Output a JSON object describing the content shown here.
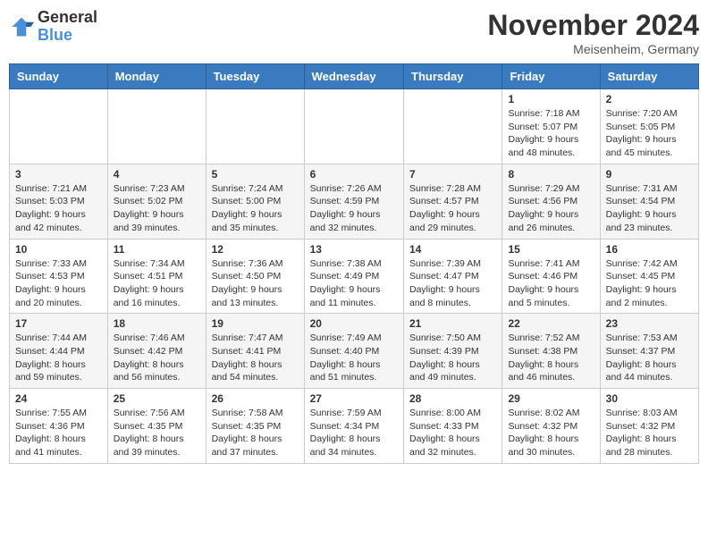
{
  "logo": {
    "general": "General",
    "blue": "Blue"
  },
  "title": "November 2024",
  "location": "Meisenheim, Germany",
  "days_of_week": [
    "Sunday",
    "Monday",
    "Tuesday",
    "Wednesday",
    "Thursday",
    "Friday",
    "Saturday"
  ],
  "weeks": [
    [
      {
        "day": "",
        "info": ""
      },
      {
        "day": "",
        "info": ""
      },
      {
        "day": "",
        "info": ""
      },
      {
        "day": "",
        "info": ""
      },
      {
        "day": "",
        "info": ""
      },
      {
        "day": "1",
        "info": "Sunrise: 7:18 AM\nSunset: 5:07 PM\nDaylight: 9 hours and 48 minutes."
      },
      {
        "day": "2",
        "info": "Sunrise: 7:20 AM\nSunset: 5:05 PM\nDaylight: 9 hours and 45 minutes."
      }
    ],
    [
      {
        "day": "3",
        "info": "Sunrise: 7:21 AM\nSunset: 5:03 PM\nDaylight: 9 hours and 42 minutes."
      },
      {
        "day": "4",
        "info": "Sunrise: 7:23 AM\nSunset: 5:02 PM\nDaylight: 9 hours and 39 minutes."
      },
      {
        "day": "5",
        "info": "Sunrise: 7:24 AM\nSunset: 5:00 PM\nDaylight: 9 hours and 35 minutes."
      },
      {
        "day": "6",
        "info": "Sunrise: 7:26 AM\nSunset: 4:59 PM\nDaylight: 9 hours and 32 minutes."
      },
      {
        "day": "7",
        "info": "Sunrise: 7:28 AM\nSunset: 4:57 PM\nDaylight: 9 hours and 29 minutes."
      },
      {
        "day": "8",
        "info": "Sunrise: 7:29 AM\nSunset: 4:56 PM\nDaylight: 9 hours and 26 minutes."
      },
      {
        "day": "9",
        "info": "Sunrise: 7:31 AM\nSunset: 4:54 PM\nDaylight: 9 hours and 23 minutes."
      }
    ],
    [
      {
        "day": "10",
        "info": "Sunrise: 7:33 AM\nSunset: 4:53 PM\nDaylight: 9 hours and 20 minutes."
      },
      {
        "day": "11",
        "info": "Sunrise: 7:34 AM\nSunset: 4:51 PM\nDaylight: 9 hours and 16 minutes."
      },
      {
        "day": "12",
        "info": "Sunrise: 7:36 AM\nSunset: 4:50 PM\nDaylight: 9 hours and 13 minutes."
      },
      {
        "day": "13",
        "info": "Sunrise: 7:38 AM\nSunset: 4:49 PM\nDaylight: 9 hours and 11 minutes."
      },
      {
        "day": "14",
        "info": "Sunrise: 7:39 AM\nSunset: 4:47 PM\nDaylight: 9 hours and 8 minutes."
      },
      {
        "day": "15",
        "info": "Sunrise: 7:41 AM\nSunset: 4:46 PM\nDaylight: 9 hours and 5 minutes."
      },
      {
        "day": "16",
        "info": "Sunrise: 7:42 AM\nSunset: 4:45 PM\nDaylight: 9 hours and 2 minutes."
      }
    ],
    [
      {
        "day": "17",
        "info": "Sunrise: 7:44 AM\nSunset: 4:44 PM\nDaylight: 8 hours and 59 minutes."
      },
      {
        "day": "18",
        "info": "Sunrise: 7:46 AM\nSunset: 4:42 PM\nDaylight: 8 hours and 56 minutes."
      },
      {
        "day": "19",
        "info": "Sunrise: 7:47 AM\nSunset: 4:41 PM\nDaylight: 8 hours and 54 minutes."
      },
      {
        "day": "20",
        "info": "Sunrise: 7:49 AM\nSunset: 4:40 PM\nDaylight: 8 hours and 51 minutes."
      },
      {
        "day": "21",
        "info": "Sunrise: 7:50 AM\nSunset: 4:39 PM\nDaylight: 8 hours and 49 minutes."
      },
      {
        "day": "22",
        "info": "Sunrise: 7:52 AM\nSunset: 4:38 PM\nDaylight: 8 hours and 46 minutes."
      },
      {
        "day": "23",
        "info": "Sunrise: 7:53 AM\nSunset: 4:37 PM\nDaylight: 8 hours and 44 minutes."
      }
    ],
    [
      {
        "day": "24",
        "info": "Sunrise: 7:55 AM\nSunset: 4:36 PM\nDaylight: 8 hours and 41 minutes."
      },
      {
        "day": "25",
        "info": "Sunrise: 7:56 AM\nSunset: 4:35 PM\nDaylight: 8 hours and 39 minutes."
      },
      {
        "day": "26",
        "info": "Sunrise: 7:58 AM\nSunset: 4:35 PM\nDaylight: 8 hours and 37 minutes."
      },
      {
        "day": "27",
        "info": "Sunrise: 7:59 AM\nSunset: 4:34 PM\nDaylight: 8 hours and 34 minutes."
      },
      {
        "day": "28",
        "info": "Sunrise: 8:00 AM\nSunset: 4:33 PM\nDaylight: 8 hours and 32 minutes."
      },
      {
        "day": "29",
        "info": "Sunrise: 8:02 AM\nSunset: 4:32 PM\nDaylight: 8 hours and 30 minutes."
      },
      {
        "day": "30",
        "info": "Sunrise: 8:03 AM\nSunset: 4:32 PM\nDaylight: 8 hours and 28 minutes."
      }
    ]
  ]
}
